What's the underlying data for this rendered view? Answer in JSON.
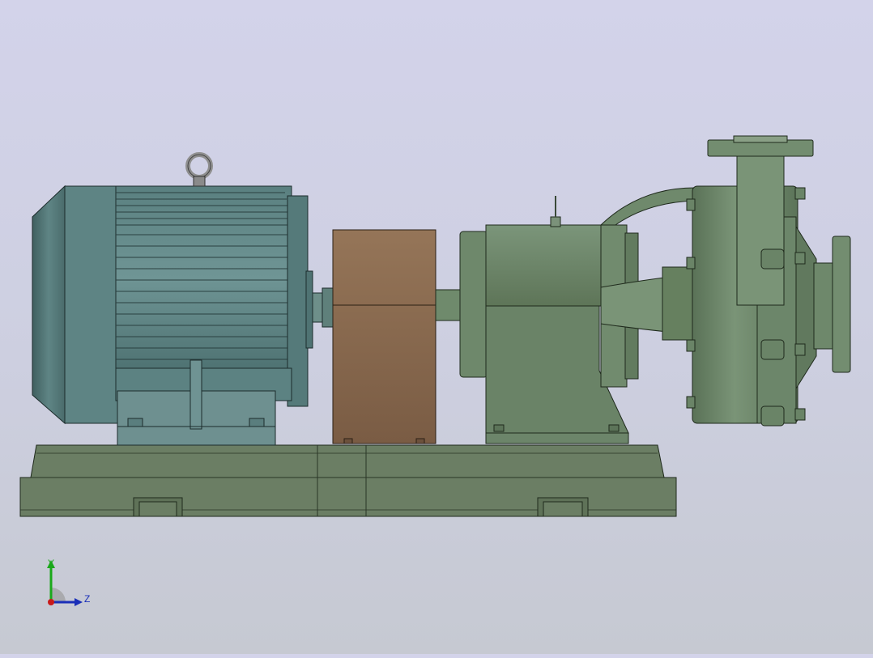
{
  "viewport": {
    "background_top": "#d3d3ea",
    "background_bottom": "#c6c9d2"
  },
  "model": {
    "motor_color": "#5f8585",
    "motor_fin_color": "#6a9090",
    "coupling_guard_color": "#8a6a4e",
    "pump_color": "#6b8466",
    "base_color": "#6b7e64",
    "eyebolt_color": "#9a9a9a"
  },
  "triad": {
    "y_label": "Y",
    "z_label": "Z",
    "y_color": "#1aa81a",
    "z_color": "#1a2fb8",
    "x_color": "#c81a1a"
  }
}
